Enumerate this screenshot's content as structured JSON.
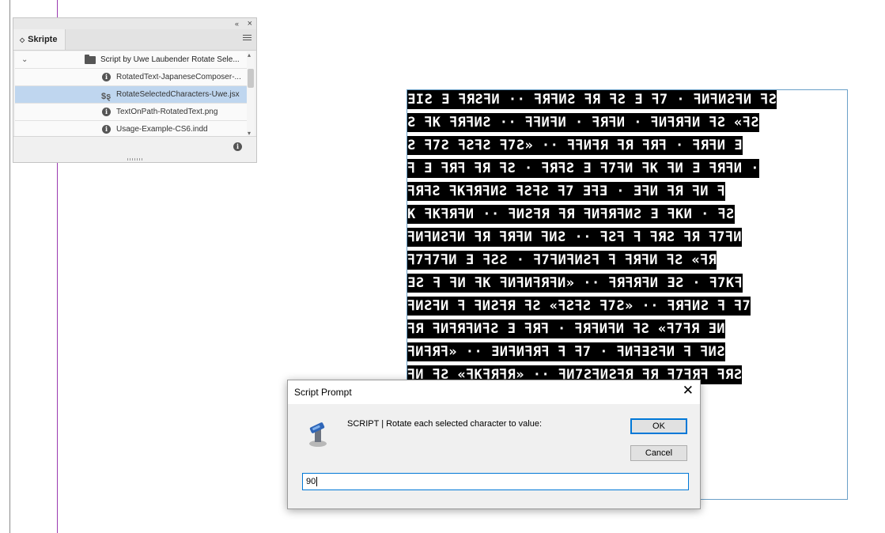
{
  "panel": {
    "tab_label": "Skripte",
    "collapse_glyph": "«",
    "close_glyph": "×",
    "folder_label": "Script by Uwe Laubender  Rotate Sele...",
    "items": [
      {
        "label": "RotatedText-JapaneseComposer-...",
        "icon": "info-icon"
      },
      {
        "label": "RotateSelectedCharacters-Uwe.jsx",
        "icon": "script-icon",
        "selected": true
      },
      {
        "label": "TextOnPath-RotatedText.png",
        "icon": "info-icon"
      },
      {
        "label": "Usage-Example-CS6.indd",
        "icon": "info-icon"
      }
    ]
  },
  "document": {
    "rotated_text_lines": [
      "ƎIƧ Ǝ ꟻЯƧꟻИ ·· ꟻЯꟻИƧ ꟻЯ ꟻƧ Ǝ ꟻ7 · ꟻИꟻИƧꟻИ ꟻƧ",
      "Ƨ ꟻK ꟻЯꟻИƧ ·· ꟻꟻИꟻИ · ꟻЯꟻИ · ꟻИꟻЯꟻИ ꟻƧ «ꟻƧ",
      "Ƨ ꟻ7Ƨ ꟻƧꟻƧ ꟻ7Ƨ» ·· ꟻꟻИꟻЯ ꟻЯ ꟻЯꟻ · ꟻЯꟻИ Ǝ",
      "ꟻ Ǝ ꟻЯꟻ ꟻЯ ꟻƧ · ꟻЯꟻƧ Ǝ ꟻ7ꟻИ ꟻK ꟻИ Ǝ ꟻЯꟻИ ·",
      "ꟻЯꟻƧ ꟻKꟻЯꟻИƧ ꟻƧꟻƧ ꟻ7 ƎꟻƎ · ƎꟻИ ꟻЯ ꟻИ ꟻ",
      "K ꟻKꟻЯꟻИ ·· ꟻИƧꟻЯ ꟻЯ ꟻИꟻЯꟻИƧ Ǝ ꟻKИ · ꟻƧ",
      "ꟻИꟻИƧꟻИ ꟻЯ ꟻЯꟻИ ꟻИƧ ·· ꟻƧꟻ ꟻ ꟻЯƧ ꟻЯ ꟻ7ꟻИ",
      "ꟻ7ꟻ7ꟻИ Ǝ ꟻƧƧ · ꟻ7ꟻИꟻИƧꟻ ꟻ ꟻЯꟻИ ꟻƧ «ꟻЯ",
      "ƎƧ ꟻ ꟻИ ꟻK ꟻИꟻИꟻЯꟻИ» ·· ꟻЯꟻЯꟻИ ƎƧ · ꟻ7Kꟻ",
      "ꟻИƧꟻИ ꟻ ꟻИƧꟻЯ ꟻƧ «ꟻƧꟻƧ ꟻ7Ƨ» ·· ꟻЯꟻИƧ ꟻ ꟻ7",
      "ꟻЯ ꟻИꟻЯꟻИꟻƧ Ǝ ꟻЯꟻ · ꟻЯꟻИꟻИ ꟻƧ «ꟻ7ꟻЯ ƎИ",
      "ꟻИꟻЯꟻ» ·· ƎИꟻИꟻЯꟻ ꟻ ꟻ7 · ꟻИꟻƎƧꟻИ ꟻ ꟻИƧ",
      "ꟻИ ꟻƧ «ꟻKꟻЯꟻЯ» ·· ꟻИ7ƧꟻИƧꟻЯ ꟻЯ ꟻ7ꟻЯꟻ ꟻЯƧ",
      "ƎꟻЯ Ǝ ꟻƧ ··"
    ],
    "pilcrow": "#"
  },
  "dialog": {
    "title": "Script Prompt",
    "close_glyph": "✕",
    "message": "SCRIPT | Rotate each selected character to value:",
    "ok_label": "OK",
    "cancel_label": "Cancel",
    "input_value": "90"
  }
}
